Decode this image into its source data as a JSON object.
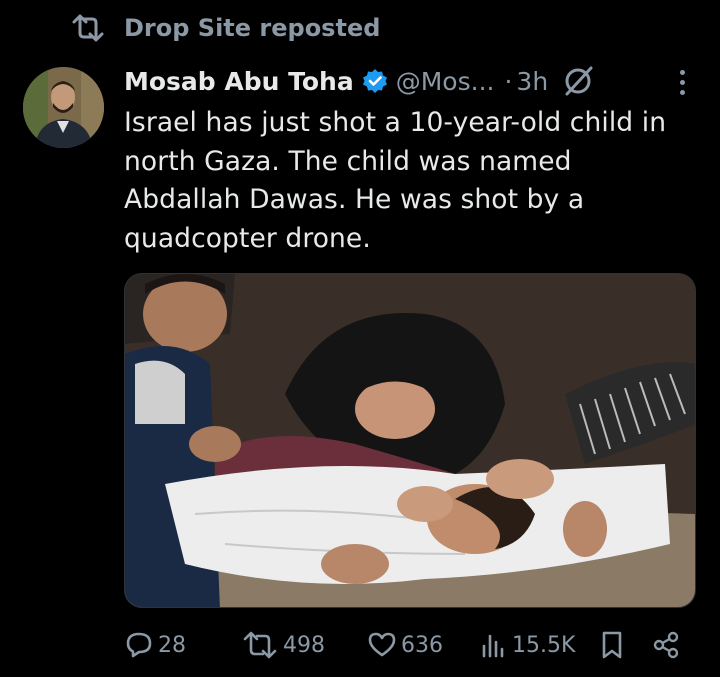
{
  "repost": {
    "label": "Drop Site reposted",
    "icon": "repost-icon"
  },
  "author": {
    "name": "Mosab Abu Toha",
    "handle": "@Mos...",
    "separator": "·",
    "time": "3h",
    "verified_icon": "verified-badge-icon",
    "avatar_icon": "avatar"
  },
  "tweet": {
    "lines": [
      "Israel has just shot a 10-year-old child in",
      "north Gaza. The child was named",
      "Abdallah Dawas. He was shot by a",
      "quadcopter drone."
    ]
  },
  "actions": {
    "replies": "28",
    "reposts": "498",
    "likes": "636",
    "views": "15.5K"
  },
  "colors": {
    "background": "#000000",
    "text": "#e7e9ea",
    "muted": "#8b98a5",
    "verified": "#1d9bf0"
  }
}
